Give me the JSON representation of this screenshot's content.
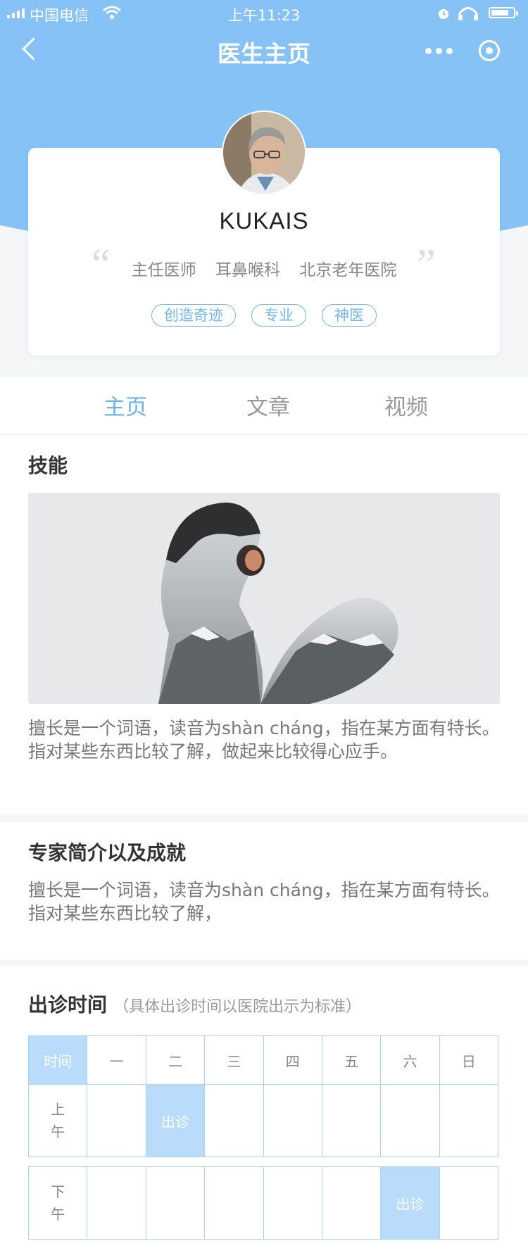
{
  "status_bar": {
    "carrier": "中国电信",
    "time": "上午11:23"
  },
  "nav": {
    "title": "医生主页"
  },
  "doctor": {
    "name": "KUKAIS",
    "title": "主任医师",
    "department": "耳鼻喉科",
    "hospital": "北京老年医院",
    "tags": [
      "创造奇迹",
      "专业",
      "神医"
    ]
  },
  "tabs": [
    {
      "label": "主页",
      "active": true
    },
    {
      "label": "文章",
      "active": false
    },
    {
      "label": "视频",
      "active": false
    }
  ],
  "skills": {
    "title": "技能",
    "text": "擅长是一个词语，读音为shàn cháng，指在某方面有特长。指对某些东西比较了解，做起来比较得心应手。"
  },
  "intro": {
    "title": "专家简介以及成就",
    "text": "擅长是一个词语，读音为shàn cháng，指在某方面有特长。指对某些东西比较了解，"
  },
  "schedule": {
    "title": "出诊时间",
    "note": "（具体出诊时间以医院出示为标准）",
    "header": [
      "时间",
      "一",
      "二",
      "三",
      "四",
      "五",
      "六",
      "日"
    ],
    "rows": [
      {
        "label": "上午",
        "cells": [
          "",
          "出诊",
          "",
          "",
          "",
          "",
          ""
        ]
      },
      {
        "label": "下午",
        "cells": [
          "",
          "",
          "",
          "",
          "",
          "出诊",
          ""
        ]
      }
    ]
  },
  "colors": {
    "primary": "#86c2f6",
    "accent": "#6ab4ee",
    "highlight": "#b8dcfa"
  }
}
